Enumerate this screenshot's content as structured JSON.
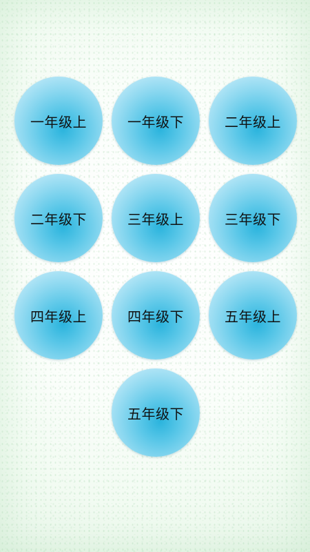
{
  "theme": {
    "button_color": "#5ac7e8",
    "button_center_color": "#2bb4dd",
    "background_color": "#f6fcf6",
    "text_color": "#111111"
  },
  "grades": [
    {
      "label": "一年级上"
    },
    {
      "label": "一年级下"
    },
    {
      "label": "二年级上"
    },
    {
      "label": "二年级下"
    },
    {
      "label": "三年级上"
    },
    {
      "label": "三年级下"
    },
    {
      "label": "四年级上"
    },
    {
      "label": "四年级下"
    },
    {
      "label": "五年级上"
    },
    {
      "label": "五年级下"
    }
  ]
}
